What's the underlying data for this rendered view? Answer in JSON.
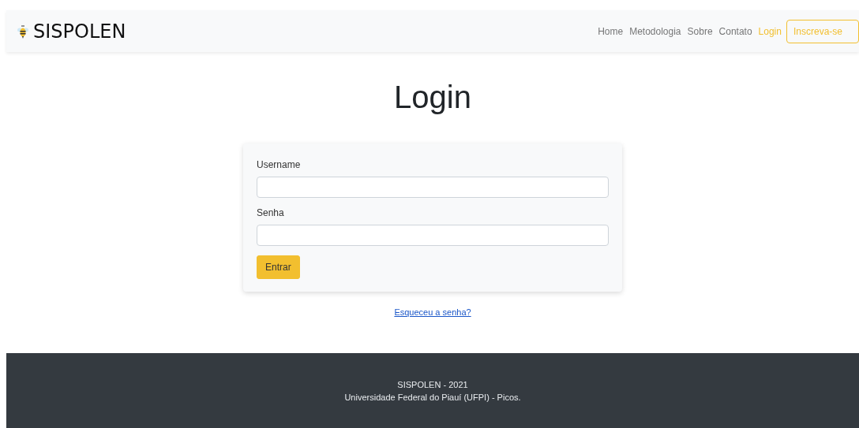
{
  "navbar": {
    "brand": "SISPOLEN",
    "links": [
      {
        "label": "Home",
        "kind": "link",
        "selected": false
      },
      {
        "label": "Metodologia",
        "kind": "link",
        "selected": false
      },
      {
        "label": "Sobre",
        "kind": "link",
        "selected": false
      },
      {
        "label": "Contato",
        "kind": "link",
        "selected": false
      },
      {
        "label": "Login",
        "kind": "link",
        "selected": true
      },
      {
        "label": "Inscreva-se",
        "kind": "button",
        "selected": false
      }
    ]
  },
  "page_title": "Login",
  "form": {
    "fields": [
      {
        "label": "Username"
      },
      {
        "label": "Senha"
      }
    ],
    "submit": "Entrar"
  },
  "forgot_link": "Esqueceu a senha?",
  "footer": {
    "lines": [
      "SISPOLEN - 2021",
      "Universidade Federal do Piauí (UFPI) - Picos."
    ]
  }
}
